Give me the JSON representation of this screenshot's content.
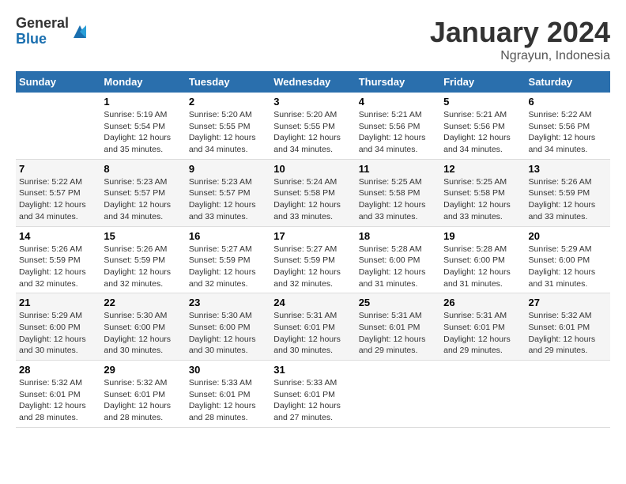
{
  "logo": {
    "general": "General",
    "blue": "Blue"
  },
  "title": "January 2024",
  "location": "Ngrayun, Indonesia",
  "days_of_week": [
    "Sunday",
    "Monday",
    "Tuesday",
    "Wednesday",
    "Thursday",
    "Friday",
    "Saturday"
  ],
  "weeks": [
    [
      {
        "day": "",
        "info": ""
      },
      {
        "day": "1",
        "info": "Sunrise: 5:19 AM\nSunset: 5:54 PM\nDaylight: 12 hours\nand 35 minutes."
      },
      {
        "day": "2",
        "info": "Sunrise: 5:20 AM\nSunset: 5:55 PM\nDaylight: 12 hours\nand 34 minutes."
      },
      {
        "day": "3",
        "info": "Sunrise: 5:20 AM\nSunset: 5:55 PM\nDaylight: 12 hours\nand 34 minutes."
      },
      {
        "day": "4",
        "info": "Sunrise: 5:21 AM\nSunset: 5:56 PM\nDaylight: 12 hours\nand 34 minutes."
      },
      {
        "day": "5",
        "info": "Sunrise: 5:21 AM\nSunset: 5:56 PM\nDaylight: 12 hours\nand 34 minutes."
      },
      {
        "day": "6",
        "info": "Sunrise: 5:22 AM\nSunset: 5:56 PM\nDaylight: 12 hours\nand 34 minutes."
      }
    ],
    [
      {
        "day": "7",
        "info": "Sunrise: 5:22 AM\nSunset: 5:57 PM\nDaylight: 12 hours\nand 34 minutes."
      },
      {
        "day": "8",
        "info": "Sunrise: 5:23 AM\nSunset: 5:57 PM\nDaylight: 12 hours\nand 34 minutes."
      },
      {
        "day": "9",
        "info": "Sunrise: 5:23 AM\nSunset: 5:57 PM\nDaylight: 12 hours\nand 33 minutes."
      },
      {
        "day": "10",
        "info": "Sunrise: 5:24 AM\nSunset: 5:58 PM\nDaylight: 12 hours\nand 33 minutes."
      },
      {
        "day": "11",
        "info": "Sunrise: 5:25 AM\nSunset: 5:58 PM\nDaylight: 12 hours\nand 33 minutes."
      },
      {
        "day": "12",
        "info": "Sunrise: 5:25 AM\nSunset: 5:58 PM\nDaylight: 12 hours\nand 33 minutes."
      },
      {
        "day": "13",
        "info": "Sunrise: 5:26 AM\nSunset: 5:59 PM\nDaylight: 12 hours\nand 33 minutes."
      }
    ],
    [
      {
        "day": "14",
        "info": "Sunrise: 5:26 AM\nSunset: 5:59 PM\nDaylight: 12 hours\nand 32 minutes."
      },
      {
        "day": "15",
        "info": "Sunrise: 5:26 AM\nSunset: 5:59 PM\nDaylight: 12 hours\nand 32 minutes."
      },
      {
        "day": "16",
        "info": "Sunrise: 5:27 AM\nSunset: 5:59 PM\nDaylight: 12 hours\nand 32 minutes."
      },
      {
        "day": "17",
        "info": "Sunrise: 5:27 AM\nSunset: 5:59 PM\nDaylight: 12 hours\nand 32 minutes."
      },
      {
        "day": "18",
        "info": "Sunrise: 5:28 AM\nSunset: 6:00 PM\nDaylight: 12 hours\nand 31 minutes."
      },
      {
        "day": "19",
        "info": "Sunrise: 5:28 AM\nSunset: 6:00 PM\nDaylight: 12 hours\nand 31 minutes."
      },
      {
        "day": "20",
        "info": "Sunrise: 5:29 AM\nSunset: 6:00 PM\nDaylight: 12 hours\nand 31 minutes."
      }
    ],
    [
      {
        "day": "21",
        "info": "Sunrise: 5:29 AM\nSunset: 6:00 PM\nDaylight: 12 hours\nand 30 minutes."
      },
      {
        "day": "22",
        "info": "Sunrise: 5:30 AM\nSunset: 6:00 PM\nDaylight: 12 hours\nand 30 minutes."
      },
      {
        "day": "23",
        "info": "Sunrise: 5:30 AM\nSunset: 6:00 PM\nDaylight: 12 hours\nand 30 minutes."
      },
      {
        "day": "24",
        "info": "Sunrise: 5:31 AM\nSunset: 6:01 PM\nDaylight: 12 hours\nand 30 minutes."
      },
      {
        "day": "25",
        "info": "Sunrise: 5:31 AM\nSunset: 6:01 PM\nDaylight: 12 hours\nand 29 minutes."
      },
      {
        "day": "26",
        "info": "Sunrise: 5:31 AM\nSunset: 6:01 PM\nDaylight: 12 hours\nand 29 minutes."
      },
      {
        "day": "27",
        "info": "Sunrise: 5:32 AM\nSunset: 6:01 PM\nDaylight: 12 hours\nand 29 minutes."
      }
    ],
    [
      {
        "day": "28",
        "info": "Sunrise: 5:32 AM\nSunset: 6:01 PM\nDaylight: 12 hours\nand 28 minutes."
      },
      {
        "day": "29",
        "info": "Sunrise: 5:32 AM\nSunset: 6:01 PM\nDaylight: 12 hours\nand 28 minutes."
      },
      {
        "day": "30",
        "info": "Sunrise: 5:33 AM\nSunset: 6:01 PM\nDaylight: 12 hours\nand 28 minutes."
      },
      {
        "day": "31",
        "info": "Sunrise: 5:33 AM\nSunset: 6:01 PM\nDaylight: 12 hours\nand 27 minutes."
      },
      {
        "day": "",
        "info": ""
      },
      {
        "day": "",
        "info": ""
      },
      {
        "day": "",
        "info": ""
      }
    ]
  ]
}
